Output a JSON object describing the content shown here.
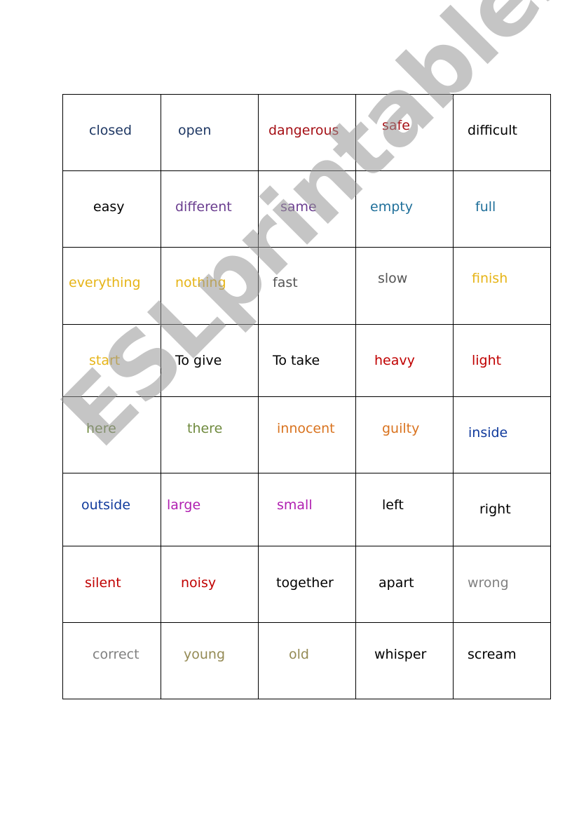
{
  "worksheet": {
    "rows": [
      [
        {
          "word": "closed",
          "color": "#1f3864"
        },
        {
          "word": "open",
          "color": "#1f3864"
        },
        {
          "word": "dangerous",
          "color": "#a50f15"
        },
        {
          "word": "safe",
          "color": "#a50f15"
        },
        {
          "word": "difficult",
          "color": "#000000"
        }
      ],
      [
        {
          "word": "easy",
          "color": "#000000"
        },
        {
          "word": "different",
          "color": "#6a3d8f"
        },
        {
          "word": "same",
          "color": "#6a3d8f"
        },
        {
          "word": "empty",
          "color": "#1f6f9a"
        },
        {
          "word": "full",
          "color": "#1f6f9a"
        }
      ],
      [
        {
          "word": "everything",
          "color": "#e6b417"
        },
        {
          "word": "nothing",
          "color": "#e6b417"
        },
        {
          "word": "fast",
          "color": "#555555"
        },
        {
          "word": "slow",
          "color": "#555555"
        },
        {
          "word": "finish",
          "color": "#e6b417"
        }
      ],
      [
        {
          "word": "start",
          "color": "#e6b417"
        },
        {
          "word": "To give",
          "color": "#000000"
        },
        {
          "word": "To take",
          "color": "#000000"
        },
        {
          "word": "heavy",
          "color": "#c00000"
        },
        {
          "word": "light",
          "color": "#c00000"
        }
      ],
      [
        {
          "word": "here",
          "color": "#6f8a3e"
        },
        {
          "word": "there",
          "color": "#6f8a3e"
        },
        {
          "word": "innocent",
          "color": "#d9731f"
        },
        {
          "word": "guilty",
          "color": "#d9731f"
        },
        {
          "word": "inside",
          "color": "#103a9c"
        }
      ],
      [
        {
          "word": "outside",
          "color": "#103a9c"
        },
        {
          "word": "large",
          "color": "#b01fb0"
        },
        {
          "word": "small",
          "color": "#b01fb0"
        },
        {
          "word": "left",
          "color": "#000000"
        },
        {
          "word": "right",
          "color": "#000000"
        }
      ],
      [
        {
          "word": "silent",
          "color": "#c00000"
        },
        {
          "word": "noisy",
          "color": "#c00000"
        },
        {
          "word": "together",
          "color": "#000000"
        },
        {
          "word": "apart",
          "color": "#000000"
        },
        {
          "word": "wrong",
          "color": "#808080"
        }
      ],
      [
        {
          "word": "correct",
          "color": "#808080"
        },
        {
          "word": "young",
          "color": "#948a54"
        },
        {
          "word": "old",
          "color": "#948a54"
        },
        {
          "word": "whisper",
          "color": "#000000"
        },
        {
          "word": "scream",
          "color": "#000000"
        }
      ]
    ]
  },
  "watermark": {
    "text": "ESLprintables.com",
    "color": "#9e9e9e"
  }
}
